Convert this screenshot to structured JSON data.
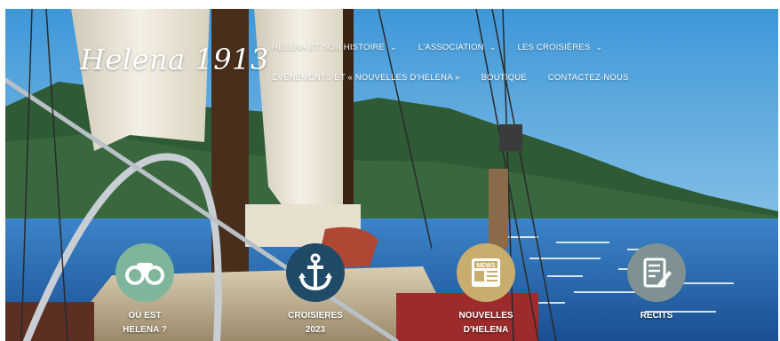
{
  "logo": {
    "text": "Helena 1913"
  },
  "nav": {
    "row1": [
      {
        "label": "HELENA ET SON HISTOIRE",
        "has_dropdown": true
      },
      {
        "label": "L'ASSOCIATION",
        "has_dropdown": true
      },
      {
        "label": "LES CROISIÈRES",
        "has_dropdown": true
      }
    ],
    "row2": [
      {
        "label": "ÉVÉNEMENTS ET « NOUVELLES D'HELENA »",
        "has_dropdown": false
      },
      {
        "label": "BOUTIQUE",
        "has_dropdown": false
      },
      {
        "label": "CONTACTEZ-NOUS",
        "has_dropdown": false
      }
    ],
    "dropdown_icon": "chevron-down-icon"
  },
  "features": [
    {
      "line1": "OÙ EST",
      "line2": "HELENA ?",
      "icon": "binoculars-icon",
      "color": "#7fb59a"
    },
    {
      "line1": "CROISIERES",
      "line2": "2023",
      "icon": "anchor-icon",
      "color": "#1f4a68"
    },
    {
      "line1": "NOUVELLES",
      "line2": "D'HELENA",
      "icon": "newspaper-icon",
      "color": "#c9ad6c"
    },
    {
      "line1": "RECITS",
      "line2": "",
      "icon": "document-pen-icon",
      "color": "#7f9192"
    }
  ],
  "colors": {
    "sky": "#4fa3dc",
    "sea": "#2a6fb6",
    "hills": "#2c5532",
    "sail": "#e9e4d5"
  }
}
